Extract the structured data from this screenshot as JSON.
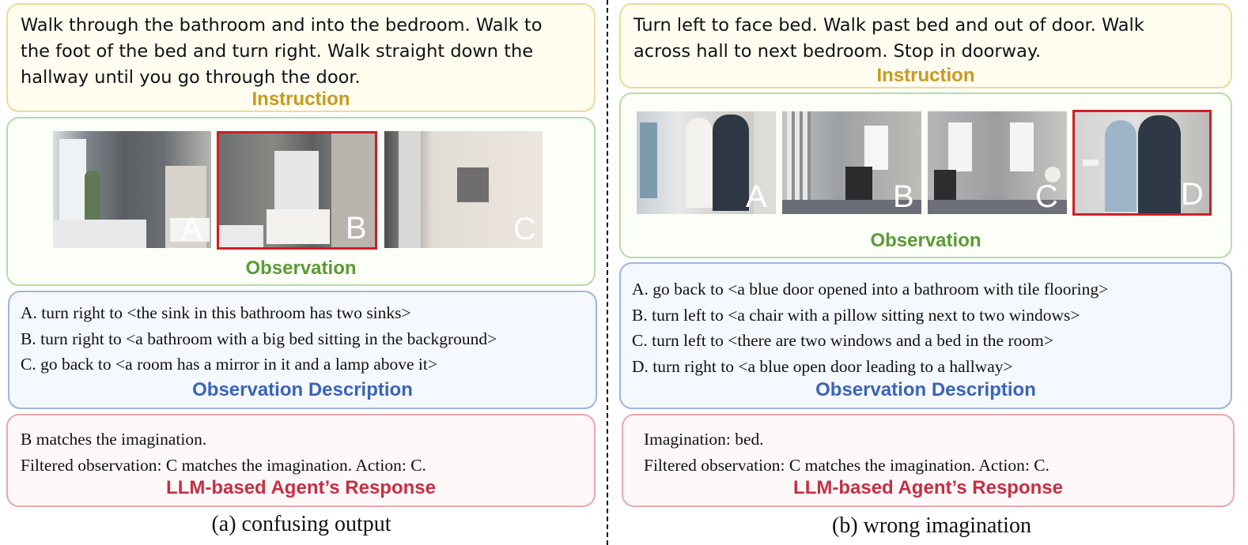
{
  "panel_a": {
    "instruction": "Walk through the bathroom and into the bedroom. Walk to\nthe foot of the bed and turn right. Walk straight down the\nhallway until you go through the door.",
    "instruction_heading": "Instruction",
    "observation_heading": "Observation",
    "views": [
      {
        "letter": "A",
        "selected": false
      },
      {
        "letter": "B",
        "selected": true
      },
      {
        "letter": "C",
        "selected": false
      }
    ],
    "descriptions": [
      "A.  turn right to <the sink in this bathroom has two sinks>",
      "B.  turn right to <a bathroom with a big bed sitting in the background>",
      "C.  go back to <a room has a mirror in it and a lamp above it>"
    ],
    "description_heading": "Observation Description",
    "response": [
      "B matches the imagination.",
      "Filtered observation: C matches the imagination. Action: C."
    ],
    "response_heading": "LLM-based Agent’s Response",
    "caption": "(a) confusing output"
  },
  "panel_b": {
    "instruction": "Turn left to face bed. Walk past bed and out of door. Walk\nacross hall to next bedroom. Stop in doorway.",
    "instruction_heading": "Instruction",
    "observation_heading": "Observation",
    "views": [
      {
        "letter": "A",
        "selected": false
      },
      {
        "letter": "B",
        "selected": false
      },
      {
        "letter": "C",
        "selected": false
      },
      {
        "letter": "D",
        "selected": true
      }
    ],
    "descriptions": [
      "A. go back to <a blue door opened into a bathroom with tile flooring>",
      "B. turn left to <a chair with a pillow sitting next to two windows>",
      "C. turn left to <there are two windows and a bed in the room>",
      "D. turn right to <a blue open door leading to a hallway>"
    ],
    "description_heading": "Observation Description",
    "response": [
      "Imagination: bed.",
      "Filtered observation: C matches the imagination. Action: C."
    ],
    "response_heading": "LLM-based Agent’s Response",
    "caption": "(b) wrong imagination"
  },
  "colors": {
    "selected_border": "#cf1f24",
    "instruction_heading": "#c89a1c",
    "observation_heading": "#5b9a34",
    "description_heading": "#3a64b5",
    "response_heading": "#c52f44"
  }
}
